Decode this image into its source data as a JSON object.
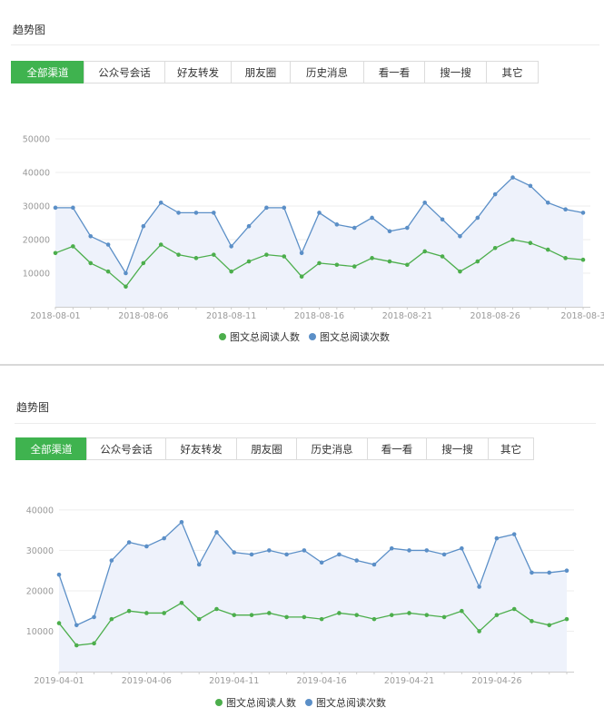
{
  "panels": [
    {
      "title": "趋势图",
      "tabs": [
        "全部渠道",
        "公众号会话",
        "好友转发",
        "朋友圈",
        "历史消息",
        "看一看",
        "搜一搜",
        "其它"
      ],
      "active_tab": 0,
      "legend": [
        "图文总阅读人数",
        "图文总阅读次数"
      ]
    },
    {
      "title": "趋势图",
      "tabs": [
        "全部渠道",
        "公众号会话",
        "好友转发",
        "朋友圈",
        "历史消息",
        "看一看",
        "搜一搜",
        "其它"
      ],
      "active_tab": 0,
      "legend": [
        "图文总阅读人数",
        "图文总阅读次数"
      ]
    }
  ],
  "colors": {
    "green": "#4cae4c",
    "blue": "#5b8fc7",
    "fill": "#eef2fb",
    "tab_active": "#3fb34f"
  },
  "chart_data": [
    {
      "type": "line",
      "x_ticks": [
        "2018-08-01",
        "2018-08-06",
        "2018-08-11",
        "2018-08-16",
        "2018-08-21",
        "2018-08-26",
        "2018-08-3"
      ],
      "y_ticks": [
        "10000",
        "20000",
        "30000",
        "40000",
        "50000"
      ],
      "ylim": [
        0,
        50000
      ],
      "grid": true,
      "legend_position": "bottom-center",
      "series": [
        {
          "name": "图文总阅读人数",
          "values": [
            16000,
            18000,
            13000,
            10500,
            6000,
            13000,
            18500,
            15500,
            14500,
            15500,
            10500,
            13500,
            15500,
            15000,
            9000,
            13000,
            12500,
            12000,
            14500,
            13500,
            12500,
            16500,
            15000,
            10500,
            13500,
            17500,
            20000,
            19000,
            17000,
            14500,
            14000
          ]
        },
        {
          "name": "图文总阅读次数",
          "values": [
            29500,
            29500,
            21000,
            18500,
            10000,
            24000,
            31000,
            28000,
            28000,
            28000,
            18000,
            24000,
            29500,
            29500,
            16000,
            28000,
            24500,
            23500,
            26500,
            22500,
            23500,
            31000,
            26000,
            21000,
            26500,
            33500,
            38500,
            36000,
            31000,
            29000,
            28000
          ]
        }
      ]
    },
    {
      "type": "line",
      "x_ticks": [
        "2019-04-01",
        "2019-04-06",
        "2019-04-11",
        "2019-04-16",
        "2019-04-21",
        "2019-04-26"
      ],
      "y_ticks": [
        "10000",
        "20000",
        "30000",
        "40000"
      ],
      "ylim": [
        0,
        42000
      ],
      "grid": true,
      "legend_position": "bottom-center",
      "series": [
        {
          "name": "图文总阅读人数",
          "values": [
            12000,
            6500,
            7000,
            13000,
            15000,
            14500,
            14500,
            17000,
            13000,
            15500,
            14000,
            14000,
            14500,
            13500,
            13500,
            13000,
            14500,
            14000,
            13000,
            14000,
            14500,
            14000,
            13500,
            15000,
            10000,
            14000,
            15500,
            12500,
            11500,
            13000
          ]
        },
        {
          "name": "图文总阅读次数",
          "values": [
            24000,
            11500,
            13500,
            27500,
            32000,
            31000,
            33000,
            37000,
            26500,
            34500,
            29500,
            29000,
            30000,
            29000,
            30000,
            27000,
            29000,
            27500,
            26500,
            30500,
            30000,
            30000,
            29000,
            30500,
            21000,
            33000,
            34000,
            24500,
            24500,
            25000
          ]
        }
      ]
    }
  ]
}
